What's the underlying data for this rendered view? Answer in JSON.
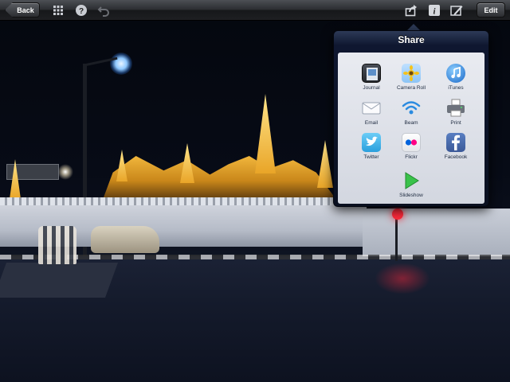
{
  "toolbar": {
    "back_label": "Back",
    "edit_label": "Edit",
    "icons": [
      "grid-icon",
      "help-icon",
      "undo-icon",
      "share-icon",
      "info-icon",
      "edit-photo-icon"
    ]
  },
  "share": {
    "title": "Share",
    "items": [
      {
        "label": "Journal",
        "icon": "journal-icon"
      },
      {
        "label": "Camera Roll",
        "icon": "camera-roll-icon"
      },
      {
        "label": "iTunes",
        "icon": "itunes-icon"
      },
      {
        "label": "Email",
        "icon": "email-icon"
      },
      {
        "label": "Beam",
        "icon": "beam-icon"
      },
      {
        "label": "Print",
        "icon": "print-icon"
      },
      {
        "label": "Twitter",
        "icon": "twitter-icon"
      },
      {
        "label": "Flickr",
        "icon": "flickr-icon"
      },
      {
        "label": "Facebook",
        "icon": "facebook-icon"
      },
      {
        "label": "Slideshow",
        "icon": "slideshow-icon"
      }
    ]
  },
  "colors": {
    "toolbar_top": "#4c4f54",
    "popover_header": "#2d3a57",
    "popover_body": "#e9ebf1"
  }
}
